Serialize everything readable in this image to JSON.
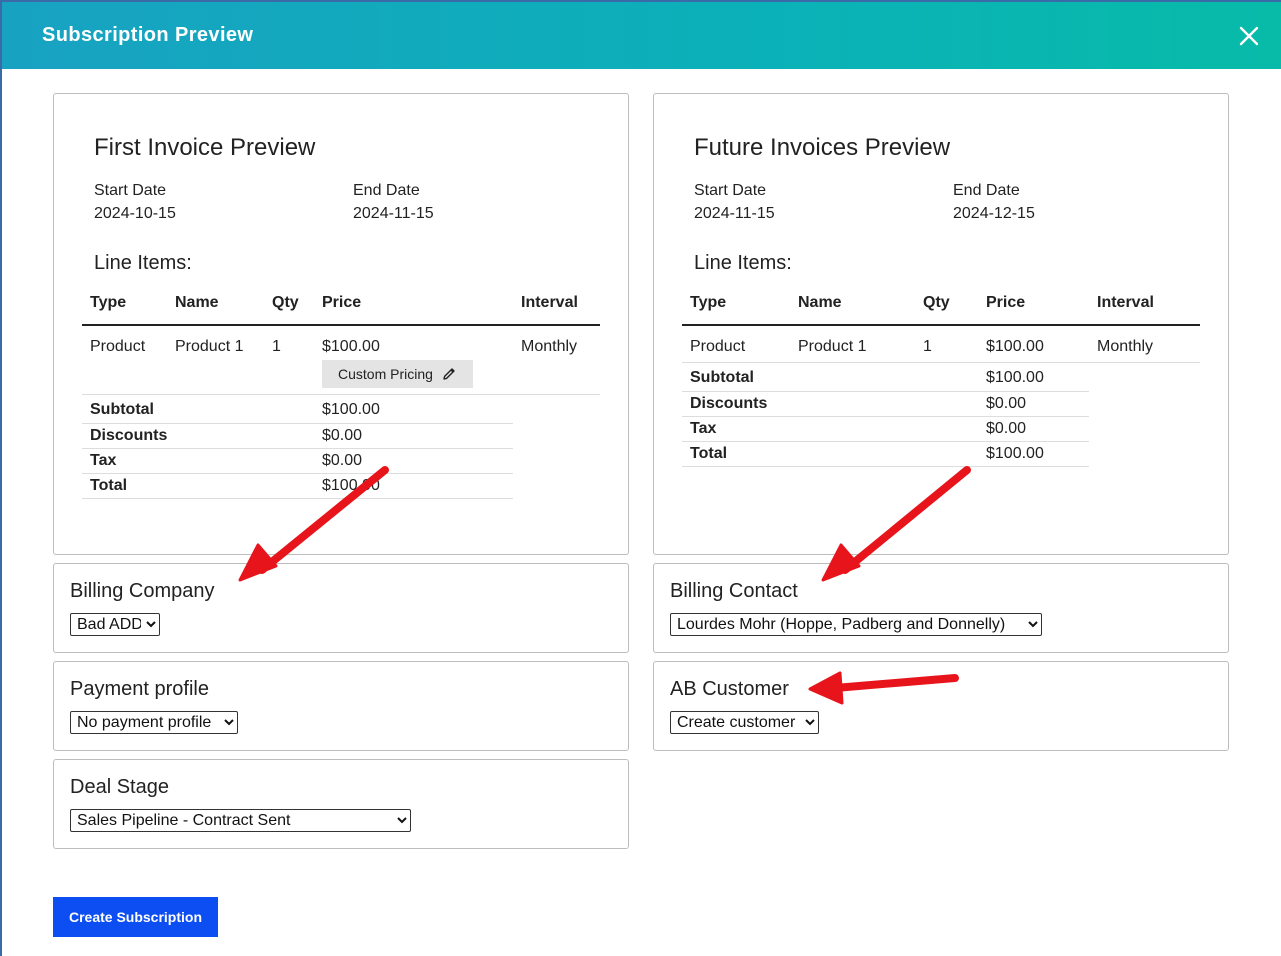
{
  "modal": {
    "title": "Subscription Preview"
  },
  "first_invoice": {
    "title": "First Invoice Preview",
    "start_label": "Start Date",
    "start_value": "2024-10-15",
    "end_label": "End Date",
    "end_value": "2024-11-15",
    "line_items_title": "Line Items:",
    "columns": [
      "Type",
      "Name",
      "Qty",
      "Price",
      "Interval"
    ],
    "row": {
      "type": "Product",
      "name": "Product 1",
      "qty": "1",
      "price": "$100.00",
      "interval": "Monthly"
    },
    "custom_pricing_label": "Custom Pricing",
    "totals": [
      {
        "label": "Subtotal",
        "value": "$100.00"
      },
      {
        "label": "Discounts",
        "value": "$0.00"
      },
      {
        "label": "Tax",
        "value": "$0.00"
      },
      {
        "label": "Total",
        "value": "$100.00"
      }
    ]
  },
  "future_invoices": {
    "title": "Future Invoices Preview",
    "start_label": "Start Date",
    "start_value": "2024-11-15",
    "end_label": "End Date",
    "end_value": "2024-12-15",
    "line_items_title": "Line Items:",
    "columns": [
      "Type",
      "Name",
      "Qty",
      "Price",
      "Interval"
    ],
    "row": {
      "type": "Product",
      "name": "Product 1",
      "qty": "1",
      "price": "$100.00",
      "interval": "Monthly"
    },
    "totals": [
      {
        "label": "Subtotal",
        "value": "$100.00"
      },
      {
        "label": "Discounts",
        "value": "$0.00"
      },
      {
        "label": "Tax",
        "value": "$0.00"
      },
      {
        "label": "Total",
        "value": "$100.00"
      }
    ]
  },
  "fields": {
    "billing_company": {
      "label": "Billing Company",
      "value": "Bad ADD"
    },
    "billing_contact": {
      "label": "Billing Contact",
      "value": "Lourdes Mohr (Hoppe, Padberg and Donnelly)"
    },
    "payment_profile": {
      "label": "Payment profile",
      "value": "No payment profile"
    },
    "ab_customer": {
      "label": "AB Customer",
      "value": "Create customer"
    },
    "deal_stage": {
      "label": "Deal Stage",
      "value": "Sales Pipeline - Contract Sent"
    }
  },
  "actions": {
    "create_label": "Create Subscription"
  },
  "icons": {
    "close": "close-icon",
    "edit": "pencil-icon",
    "chevron": "chevron-down-icon"
  },
  "colors": {
    "header_start": "#18a2c2",
    "header_end": "#08bba8",
    "primary_button": "#0d4ef2",
    "annotation_arrow": "#e8141b"
  }
}
